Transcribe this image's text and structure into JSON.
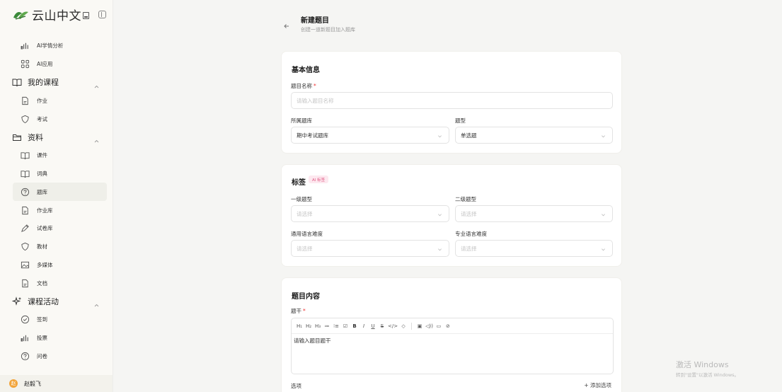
{
  "brand": {
    "name": "云山中文"
  },
  "sidebar": {
    "items": [
      {
        "label": "AI学情分析",
        "icon": "bar-chart-icon",
        "kind": "sub"
      },
      {
        "label": "AI应用",
        "icon": "grid-icon",
        "kind": "sub"
      },
      {
        "label": "我的课程",
        "icon": "book-open-icon",
        "kind": "group",
        "expanded": true
      },
      {
        "label": "作业",
        "icon": "file-icon",
        "kind": "sub"
      },
      {
        "label": "考试",
        "icon": "shield-icon",
        "kind": "sub"
      },
      {
        "label": "资料",
        "icon": "folder-icon",
        "kind": "group",
        "expanded": true
      },
      {
        "label": "课件",
        "icon": "book-open-icon",
        "kind": "sub"
      },
      {
        "label": "词典",
        "icon": "book-open-icon",
        "kind": "sub"
      },
      {
        "label": "题库",
        "icon": "help-circle-icon",
        "kind": "sub",
        "active": true
      },
      {
        "label": "作业库",
        "icon": "file-icon",
        "kind": "sub"
      },
      {
        "label": "试卷库",
        "icon": "pen-icon",
        "kind": "sub"
      },
      {
        "label": "教材",
        "icon": "shield-icon",
        "kind": "sub"
      },
      {
        "label": "多媒体",
        "icon": "image-icon",
        "kind": "sub"
      },
      {
        "label": "文档",
        "icon": "file-icon",
        "kind": "sub"
      },
      {
        "label": "课程活动",
        "icon": "sparkles-icon",
        "kind": "group",
        "expanded": true
      },
      {
        "label": "签到",
        "icon": "check-circle-icon",
        "kind": "sub"
      },
      {
        "label": "投票",
        "icon": "bar-chart-icon",
        "kind": "sub"
      },
      {
        "label": "问卷",
        "icon": "help-circle-icon",
        "kind": "sub"
      }
    ]
  },
  "user": {
    "initial": "赵",
    "name": "赵毅飞"
  },
  "header": {
    "title": "新建题目",
    "subtitle": "创建一道新题目加入题库"
  },
  "basic": {
    "title": "基本信息",
    "name_label": "题目名称",
    "name_placeholder": "请输入题目名称",
    "bank_label": "所属题库",
    "bank_value": "期中考试题库",
    "type_label": "题型",
    "type_value": "单选题"
  },
  "tags": {
    "title": "标签",
    "ai_badge": "AI 标签",
    "level1_label": "一级题型",
    "level1_placeholder": "请选择",
    "level2_label": "二级题型",
    "level2_placeholder": "请选择",
    "general_label": "通用语言难度",
    "general_placeholder": "请选择",
    "pro_label": "专业语言难度",
    "pro_placeholder": "请选择"
  },
  "content": {
    "title": "题目内容",
    "stem_label": "题干",
    "stem_placeholder": "请输入题目题干",
    "toolbar": [
      "H₁",
      "H₂",
      "H₃",
      "≔",
      "⁝≡",
      "☑",
      "B",
      "I",
      "U",
      "S",
      "</>",
      "◇",
      "▣",
      "◁))",
      "▭",
      "⊘"
    ],
    "options_label": "选项",
    "add_option": "+ 添加选项"
  },
  "watermark": {
    "line1": "激活 Windows",
    "line2": "转到\"设置\"以激活 Windows。"
  }
}
